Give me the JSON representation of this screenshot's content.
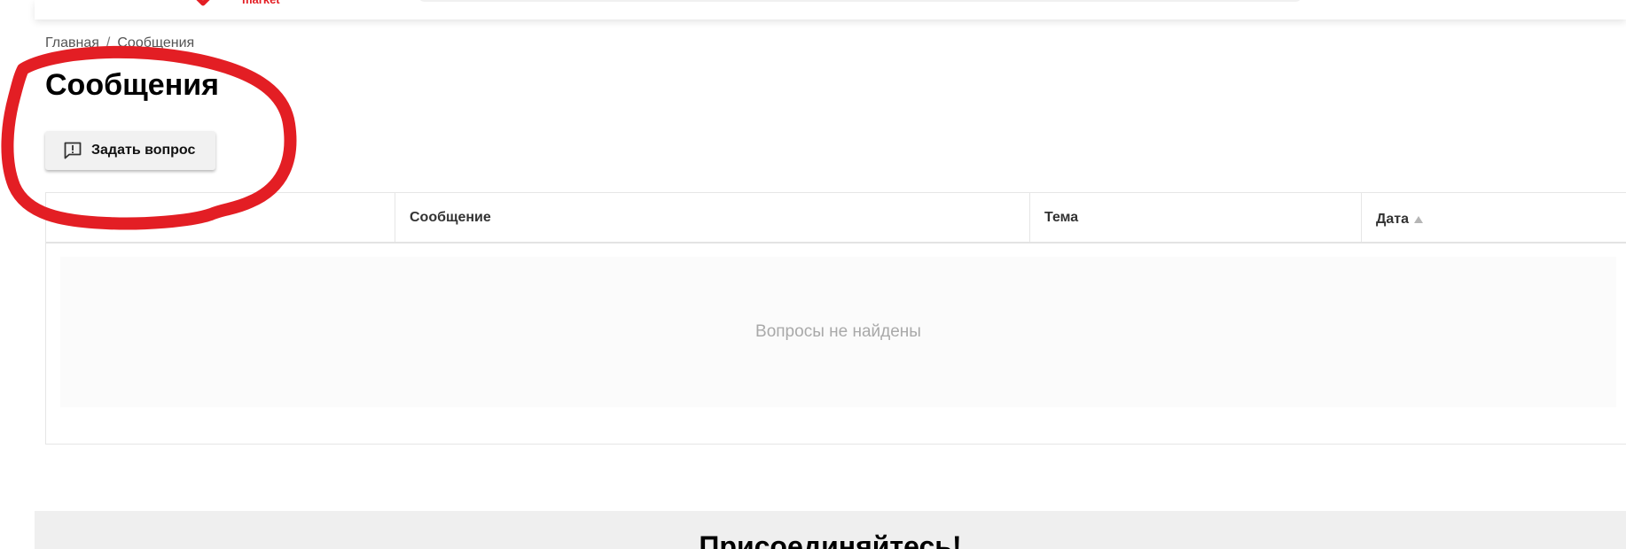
{
  "header": {
    "logo_text": "market",
    "logo_icon": "shield-logo-icon",
    "brand_color": "#e31e24"
  },
  "breadcrumb": {
    "items": [
      "Главная",
      "Сообщения"
    ],
    "separator": "/"
  },
  "page": {
    "title": "Сообщения"
  },
  "actions": {
    "ask_button_label": "Задать вопрос",
    "ask_button_icon": "feedback-exclamation-icon"
  },
  "table": {
    "columns": [
      "",
      "Сообщение",
      "Тема",
      "Дата"
    ],
    "sort_column": "Дата",
    "sort_direction": "ascending",
    "empty_text": "Вопросы не найдены"
  },
  "footer": {
    "title": "Присоединяйтесь!"
  },
  "annotation": {
    "shape": "hand-drawn circle",
    "color": "#e31e24"
  }
}
